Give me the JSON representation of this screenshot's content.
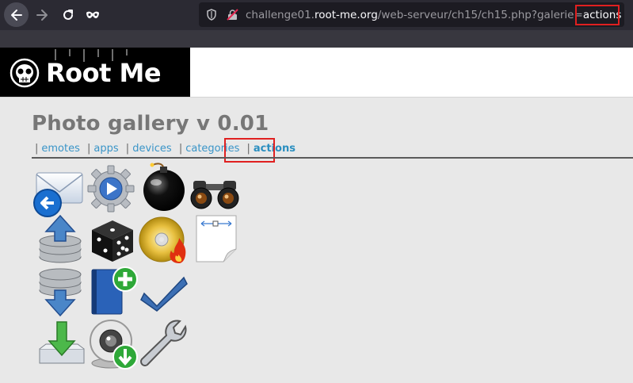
{
  "browser": {
    "url_prefix": "challenge01.",
    "url_host": "root-me.org",
    "url_path": "/web-serveur/ch15/ch15.php?galerie=",
    "url_param_value": "actions"
  },
  "header": {
    "logo_text": "Root Me"
  },
  "page": {
    "title": "Photo gallery v 0.01",
    "separator": "|",
    "nav": [
      "emotes",
      "apps",
      "devices",
      "categories",
      "actions"
    ],
    "active_nav": "actions"
  },
  "gallery": {
    "icons": [
      "mail-reply-icon",
      "gear-play-icon",
      "bomb-icon",
      "binoculars-icon",
      "database-upload-icon",
      "dice-icon",
      "cd-burn-icon",
      "page-setup-icon",
      "database-download-icon",
      "address-book-add-icon",
      "checkmark-icon",
      "download-tray-icon",
      "webcam-download-icon",
      "wrench-icon"
    ]
  },
  "colors": {
    "accent": "#3a95c8",
    "highlight": "#e02020"
  }
}
